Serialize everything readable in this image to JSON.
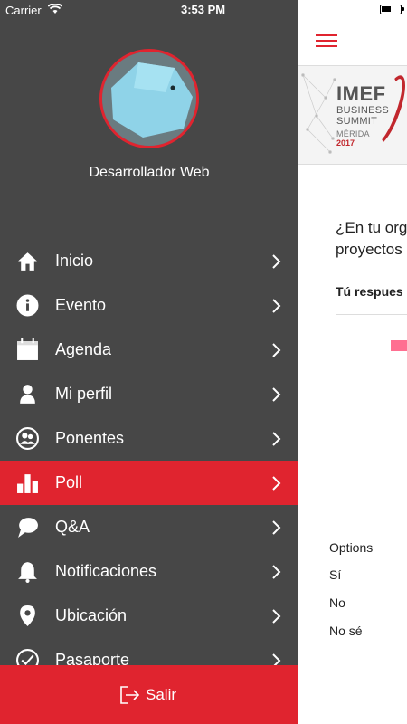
{
  "status_bar": {
    "carrier": "Carrier",
    "time": "3:53 PM"
  },
  "drawer": {
    "username": "Desarrollador Web",
    "menu": [
      {
        "label": "Inicio",
        "icon": "home-icon"
      },
      {
        "label": "Evento",
        "icon": "info-icon"
      },
      {
        "label": "Agenda",
        "icon": "calendar-icon"
      },
      {
        "label": "Mi perfil",
        "icon": "person-icon"
      },
      {
        "label": "Ponentes",
        "icon": "speakers-icon"
      },
      {
        "label": "Poll",
        "icon": "bar-chart-icon",
        "active": true
      },
      {
        "label": "Q&A",
        "icon": "chat-bubble-icon"
      },
      {
        "label": "Notificaciones",
        "icon": "bell-icon"
      },
      {
        "label": "Ubicación",
        "icon": "location-pin-icon"
      },
      {
        "label": "Pasaporte",
        "icon": "check-circle-icon"
      }
    ],
    "logout_label": "Salir"
  },
  "content": {
    "banner": {
      "brand": "IMEF",
      "line1": "BUSINESS",
      "line2": "SUMMIT",
      "city": "MÉRIDA",
      "year": "2017"
    },
    "question_line1": "¿En tu org",
    "question_line2": "proyectos",
    "answer_label": "Tú respues",
    "options_header": "Options",
    "options": [
      "Sí",
      "No",
      "No sé"
    ]
  },
  "colors": {
    "accent": "#e0242f",
    "drawer_bg": "#474747",
    "bar": "#ff6f91"
  }
}
